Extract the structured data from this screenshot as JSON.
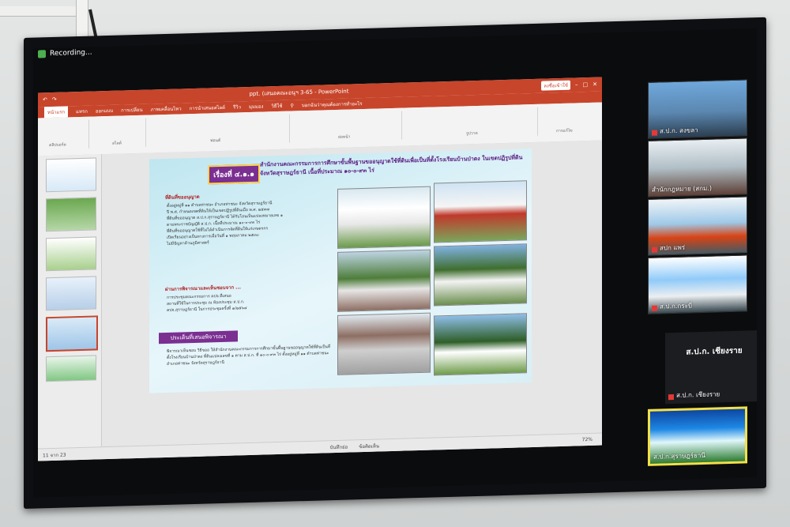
{
  "recording": {
    "label": "Recording..."
  },
  "powerpoint": {
    "window_title": "ppt. (เสนอคณะอนุฯ 3-65  -  PowerPoint",
    "signin_button": "ลงชื่อเข้าใช้",
    "menu_tabs": [
      "หน้าแรก",
      "แทรก",
      "ออกแบบ",
      "การเปลี่ยน",
      "ภาพเคลื่อนไหว",
      "การนำเสนอสไลด์",
      "รีวิว",
      "มุมมอง",
      "วิธีใช้"
    ],
    "search_hint": "บอกฉันว่าคุณต้องการทำอะไร",
    "ribbon_groups": [
      "คลิปบอร์ด",
      "สไลด์",
      "ฟอนต์",
      "ย่อหน้า",
      "รูปวาด",
      "การแก้ไข"
    ],
    "slide": {
      "badge": "เรื่องที่ ๔.๑.๑",
      "heading": "สำนักงานคณะกรรมการการศึกษาขั้นพื้นฐานขออนุญาตใช้ที่ดินเพื่อเป็นที่ตั้งโรงเรียนบ้านป่าตง ในเขตปฏิรูปที่ดินจังหวัดสุราษฎร์ธานี  เนื้อที่ประมาณ ๑๐-๐-๙๓ ไร่",
      "section1": "ที่ดินที่ขออนุญาต",
      "section2": "ผ่านการพิจารณาและเห็นชอบจาก ...",
      "consider_label": "ประเด็นที่เสนอพิจารณา",
      "bullets1": [
        "ตั้งอยู่หมู่ที่ ๑๑ ตำบลท่าชนะ อำเภอท่าชนะ จังหวัดสุราษฎร์ธานี",
        "ปี พ.ศ. กำหนดเขตที่ดินให้เป็นเขตปฏิรูปที่ดินเมื่อ พ.ศ. ๒๕๓๗",
        "ที่ดินที่ขออนุญาต ส.ป.ก.สุราษฎร์ธานี ได้รับโอนเป็นแปลงหมายเลข ๑",
        "ตามพระราชบัญญัติ ส.ป.ก. เนื้อที่ประมาณ ๑๐-๐-๙๓ ไร่",
        "ที่ดินที่ขออนุญาตใช้ที่ไม่ได้ดำเนินการจัดที่ดินให้แก่เกษตรกร",
        "เปิดเรียนอย่างเป็นทางการเมื่อวันที่ ๑ พฤษภาคม ๒๕๓๐",
        "ไม่มีปัญหาด้านภูมิศาสตร์"
      ],
      "bullets2": [
        "การประชุมคณะกรรมการ คปจ.ที่เสนอ",
        "สถานที่ใช้ในการประชุม ณ ห้องประชุม ส.ป.ก.",
        "คปจ.สุราษฎร์ธานี ในการประชุมครั้งที่ ๑/๒๕๖๔"
      ],
      "bullets3": [
        "พิจารณาเห็นชอบ วิธีขออ ให้สำนักงานคณะกรรมการการศึกษาขั้นพื้นฐานขออนุญาตใช้ที่ดินเป็นที่ตั้งโรงเรียนบ้านป่าตง ที่ดินแปลงเลขที่ ๑ ตาม ส.ป.ก. ที่ ๑๐-๐-๙๓ ไร่ ตั้งอยู่หมู่ที่ ๑๑ ตำบลท่าชนะ อำเภอท่าชนะ จังหวัดสุราษฎร์ธานี"
      ]
    },
    "status_bar": {
      "slide_count": "11 จาก 23",
      "notes": "บันทึกย่อ",
      "comments": "ข้อคิดเห็น",
      "zoom": "72%"
    }
  },
  "participants": [
    {
      "name": "ส.ป.ก. สงขลา",
      "muted": true
    },
    {
      "name": "สำนักกฎหมาย (สกม.)",
      "muted": false
    },
    {
      "name": "สปก แพร่",
      "muted": true
    },
    {
      "name": "ส.ป.ก.กระบี่",
      "muted": true
    },
    {
      "name": "ส.ป.ก. เชียงราย",
      "big_label": "ส.ป.ก. เชียงราย",
      "muted": true
    },
    {
      "name": "ส.ป.ก.สุราษฎร์ธานี",
      "muted": false,
      "active": true
    }
  ],
  "colors": {
    "ppt_accent": "#c7452b",
    "slide_badge": "#7a2f91",
    "active_border": "#f2e04a",
    "muted_icon": "#e53935"
  }
}
